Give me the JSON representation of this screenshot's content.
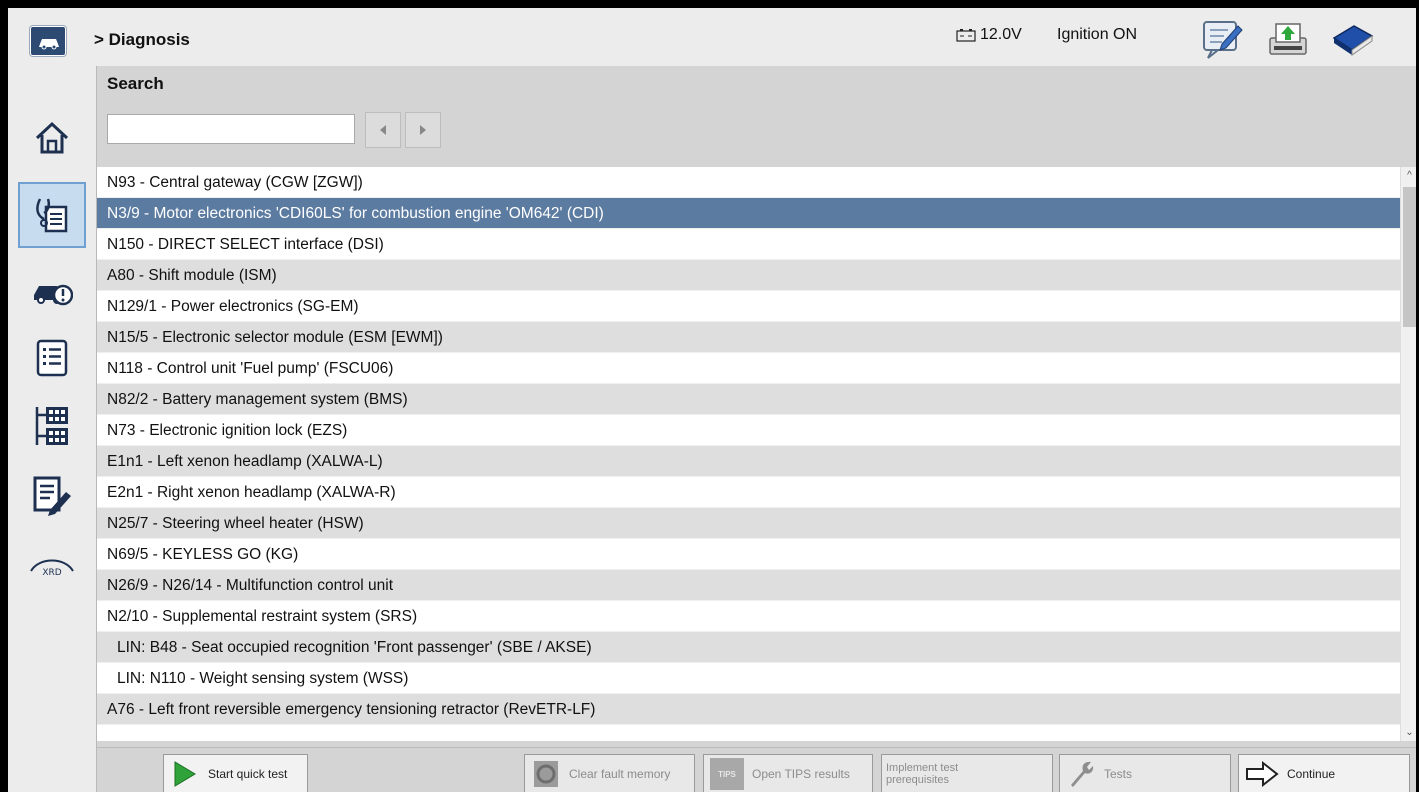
{
  "header": {
    "breadcrumb": "> Diagnosis",
    "voltage": "12.0V",
    "ignition": "Ignition ON",
    "icons": [
      "car-icon",
      "notepad-icon",
      "printer-upload-icon",
      "book-icon"
    ]
  },
  "sidebar": {
    "items": [
      {
        "name": "home-icon"
      },
      {
        "name": "diagnosis-icon",
        "active": true
      },
      {
        "name": "car-warning-icon"
      },
      {
        "name": "list-icon"
      },
      {
        "name": "network-modules-icon"
      },
      {
        "name": "edit-document-icon"
      },
      {
        "name": "xrd-icon",
        "label": "XRD"
      }
    ]
  },
  "search": {
    "label": "Search",
    "value": "",
    "placeholder": ""
  },
  "list": {
    "selected_index": 1,
    "rows": [
      "N93 - Central gateway (CGW [ZGW])",
      "N3/9 - Motor electronics 'CDI60LS' for combustion engine 'OM642' (CDI)",
      "N150 - DIRECT SELECT interface (DSI)",
      "A80 - Shift module (ISM)",
      "N129/1 - Power electronics (SG-EM)",
      "N15/5 - Electronic selector module (ESM [EWM])",
      "N118 - Control unit 'Fuel pump' (FSCU06)",
      "N82/2 - Battery management system (BMS)",
      "N73 - Electronic ignition lock (EZS)",
      "E1n1 - Left xenon headlamp (XALWA-L)",
      "E2n1 - Right xenon headlamp (XALWA-R)",
      "N25/7 - Steering wheel heater (HSW)",
      "N69/5 - KEYLESS GO (KG)",
      "N26/9 - N26/14 - Multifunction control unit",
      "N2/10 - Supplemental restraint system (SRS)",
      "LIN: B48 - Seat occupied recognition 'Front passenger' (SBE / AKSE)",
      "LIN: N110 - Weight sensing system (WSS)",
      "A76 - Left front reversible emergency tensioning retractor (RevETR-LF)"
    ]
  },
  "toolbar": {
    "start_quick_test": "Start quick test",
    "clear_fault_memory": "Clear fault memory",
    "tips_badge": "TIPS",
    "open_tips_results": "Open TIPS results",
    "implement_test_line1": "Implement test",
    "implement_test_line2": "prerequisites",
    "tests": "Tests",
    "continue": "Continue"
  },
  "colors": {
    "selected_row": "#5c7ba0",
    "accent": "#2d4a73",
    "play_green": "#2fa33a"
  }
}
